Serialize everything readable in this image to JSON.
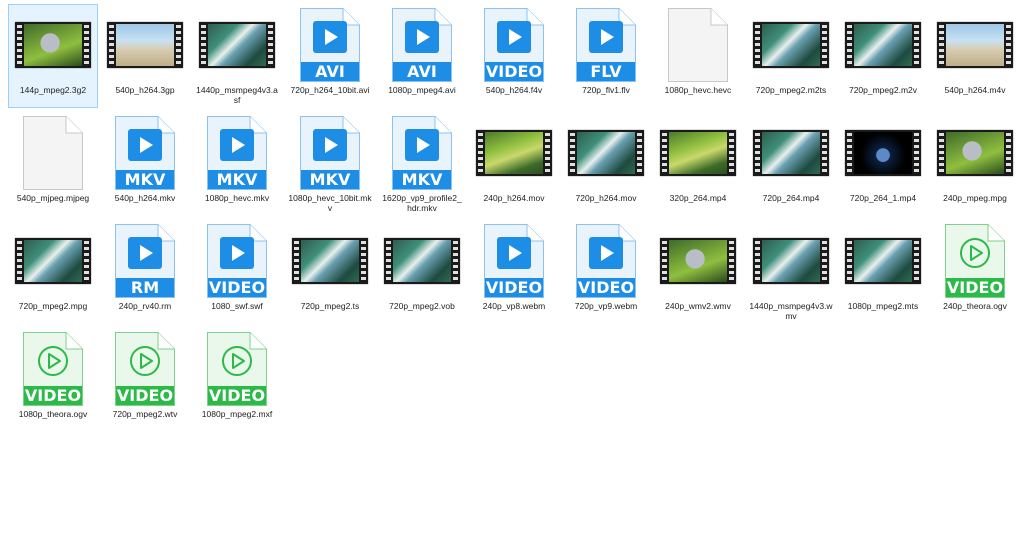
{
  "colors": {
    "blue": "#1e8de5",
    "green": "#2bba47",
    "blue_fill": "#e9f3fc",
    "green_fill": "#eaf8ec",
    "blank_fill": "#f4f4f4"
  },
  "files": [
    {
      "name": "144p_mpeg2.3g2",
      "kind": "film",
      "scene": "bunny",
      "selected": true
    },
    {
      "name": "540p_h264.3gp",
      "kind": "film",
      "scene": "beach"
    },
    {
      "name": "1440p_msmpeg4v3.asf",
      "kind": "film",
      "scene": "ocean"
    },
    {
      "name": "720p_h264_10bit.avi",
      "kind": "doc",
      "badge": "AVI",
      "style": "blue"
    },
    {
      "name": "1080p_mpeg4.avi",
      "kind": "doc",
      "badge": "AVI",
      "style": "blue"
    },
    {
      "name": "540p_h264.f4v",
      "kind": "doc",
      "badge": "VIDEO",
      "style": "blue"
    },
    {
      "name": "720p_flv1.flv",
      "kind": "doc",
      "badge": "FLV",
      "style": "blue"
    },
    {
      "name": "1080p_hevc.hevc",
      "kind": "blank"
    },
    {
      "name": "720p_mpeg2.m2ts",
      "kind": "film",
      "scene": "ocean"
    },
    {
      "name": "720p_mpeg2.m2v",
      "kind": "film",
      "scene": "ocean"
    },
    {
      "name": "540p_h264.m4v",
      "kind": "film",
      "scene": "beach"
    },
    {
      "name": "540p_mjpeg.mjpeg",
      "kind": "blank"
    },
    {
      "name": "540p_h264.mkv",
      "kind": "doc",
      "badge": "MKV",
      "style": "blue"
    },
    {
      "name": "1080p_hevc.mkv",
      "kind": "doc",
      "badge": "MKV",
      "style": "blue"
    },
    {
      "name": "1080p_hevc_10bit.mkv",
      "kind": "doc",
      "badge": "MKV",
      "style": "blue"
    },
    {
      "name": "1620p_vp9_profile2_hdr.mkv",
      "kind": "doc",
      "badge": "MKV",
      "style": "blue"
    },
    {
      "name": "240p_h264.mov",
      "kind": "film",
      "scene": "forest"
    },
    {
      "name": "720p_h264.mov",
      "kind": "film",
      "scene": "ocean"
    },
    {
      "name": "320p_264.mp4",
      "kind": "film",
      "scene": "forest"
    },
    {
      "name": "720p_264.mp4",
      "kind": "film",
      "scene": "ocean"
    },
    {
      "name": "720p_264_1.mp4",
      "kind": "film",
      "scene": "earth"
    },
    {
      "name": "240p_mpeg.mpg",
      "kind": "film",
      "scene": "bunny"
    },
    {
      "name": "720p_mpeg2.mpg",
      "kind": "film",
      "scene": "ocean"
    },
    {
      "name": "240p_rv40.rm",
      "kind": "doc",
      "badge": "RM",
      "style": "blue"
    },
    {
      "name": "1080_swf.swf",
      "kind": "doc",
      "badge": "VIDEO",
      "style": "blue"
    },
    {
      "name": "720p_mpeg2.ts",
      "kind": "film",
      "scene": "ocean"
    },
    {
      "name": "720p_mpeg2.vob",
      "kind": "film",
      "scene": "ocean"
    },
    {
      "name": "240p_vp8.webm",
      "kind": "doc",
      "badge": "VIDEO",
      "style": "blue"
    },
    {
      "name": "720p_vp9.webm",
      "kind": "doc",
      "badge": "VIDEO",
      "style": "blue"
    },
    {
      "name": "240p_wmv2.wmv",
      "kind": "film",
      "scene": "bunny"
    },
    {
      "name": "1440p_msmpeg4v3.wmv",
      "kind": "film",
      "scene": "ocean"
    },
    {
      "name": "1080p_mpeg2.mts",
      "kind": "film",
      "scene": "ocean"
    },
    {
      "name": "240p_theora.ogv",
      "kind": "doc",
      "badge": "VIDEO",
      "style": "green"
    },
    {
      "name": "1080p_theora.ogv",
      "kind": "doc",
      "badge": "VIDEO",
      "style": "green"
    },
    {
      "name": "720p_mpeg2.wtv",
      "kind": "doc",
      "badge": "VIDEO",
      "style": "green"
    },
    {
      "name": "1080p_mpeg2.mxf",
      "kind": "doc",
      "badge": "VIDEO",
      "style": "green"
    }
  ]
}
